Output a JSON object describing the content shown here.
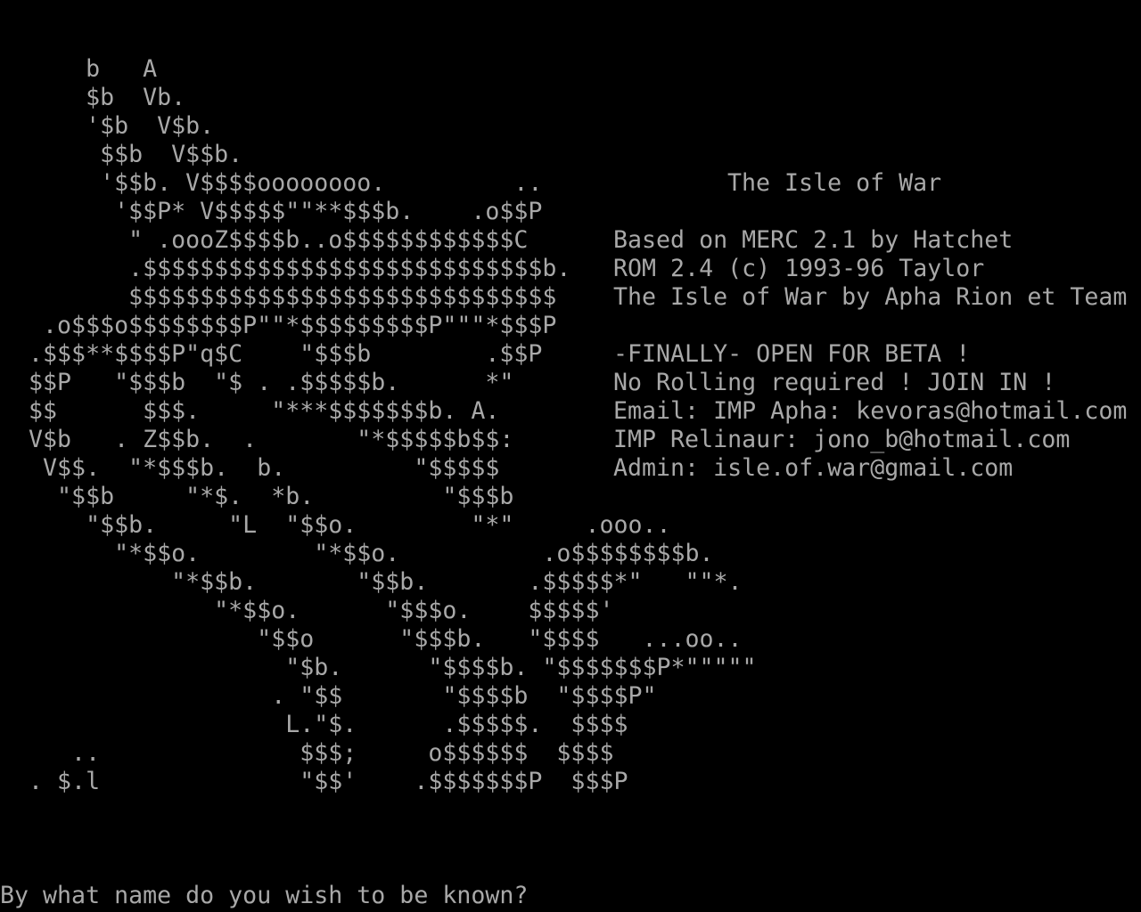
{
  "colors": {
    "background": "#000000",
    "text": "#a8a8a8"
  },
  "ascii_art": [
    "      b   A",
    "      $b  Vb.",
    "      '$b  V$b.",
    "       $$b  V$$b.",
    "       '$$b. V$$$$oooooooo.         ..",
    "        '$$P* V$$$$$\"\"**$$$b.    .o$$P",
    "         \" .oooZ$$$$b..o$$$$$$$$$$$$C",
    "         .$$$$$$$$$$$$$$$$$$$$$$$$$$$$b.",
    "         $$$$$$$$$$$$$$$$$$$$$$$$$$$$$$",
    "   .o$$$o$$$$$$$$P\"\"*$$$$$$$$$P\"\"\"*$$$P",
    "  .$$$**$$$$P\"q$C    \"$$$b        .$$P",
    "  $$P   \"$$$b  \"$ . .$$$$$b.      *\"",
    "  $$      $$$.     \"***$$$$$$$b. A.",
    "  V$b   . Z$$b.  .       \"*$$$$$b$$:",
    "   V$$.  \"*$$$b.  b.         \"$$$$$",
    "    \"$$b     \"*$.  *b.         \"$$$b",
    "      \"$$b.     \"L  \"$$o.        \"*\"     .ooo..",
    "        \"*$$o.        \"*$$o.          .o$$$$$$$$b.",
    "            \"*$$b.       \"$$b.       .$$$$$*\"   \"\"*.",
    "               \"*$$o.      \"$$$o.    $$$$$'",
    "                  \"$$o      \"$$$b.   \"$$$$   ...oo..",
    "                    \"$b.      \"$$$$b. \"$$$$$$$P*\"\"\"\"\"",
    "                   . \"$$       \"$$$$b  \"$$$$P\"",
    "                    L.\"$.      .$$$$$.  $$$$",
    "     ..              $$$;     o$$$$$$  $$$$",
    "  . $.l              \"$$'    .$$$$$$$P  $$$P"
  ],
  "info": {
    "title": "The Isle of War",
    "based_on": "Based on MERC 2.1 by Hatchet",
    "rom": "ROM 2.4 (c) 1993-96 Taylor",
    "credits": "The Isle of War by Apha Rion et Team",
    "beta": "-FINALLY- OPEN FOR BETA !",
    "rolling": "No Rolling required ! JOIN IN !",
    "email_apha": "Email: IMP Apha: kevoras@hotmail.com",
    "email_relinaur": "IMP Relinaur: jono_b@hotmail.com",
    "email_admin": "Admin: isle.of.war@gmail.com"
  },
  "prompt": {
    "text": "By what name do you wish to be known?",
    "value": ""
  }
}
